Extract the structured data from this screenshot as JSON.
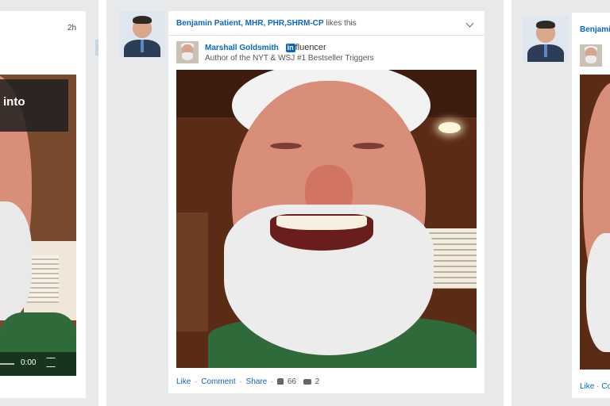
{
  "left_card": {
    "time": "2h",
    "overlay_text": "into",
    "video_time": "0:00",
    "fullscreen_icon": "fullscreen-icon"
  },
  "middle_card": {
    "liker_name": "Benjamin Patient, MHR, PHR,SHRM-CP",
    "likes_text": "likes this",
    "menu_icon": "chevron-down-icon",
    "author_name": "Marshall Goldsmith",
    "badge_in": "in",
    "badge_text": "fluencer",
    "author_headline": "Author of the NYT & WSJ #1 Bestseller Triggers",
    "actions": {
      "like": "Like",
      "comment": "Comment",
      "share": "Share",
      "separator": "·",
      "like_count": "66",
      "comment_count": "2"
    }
  },
  "right_card": {
    "liker_name_partial": "Benjamin",
    "action_like": "Like",
    "action_partial": "Co"
  },
  "colors": {
    "link": "#0a66c2",
    "feed_bg": "#e8e9eb",
    "card_bg": "#ffffff",
    "beard": "#ececec",
    "skin": "#d98e79",
    "shirt": "#2f6b3a"
  }
}
